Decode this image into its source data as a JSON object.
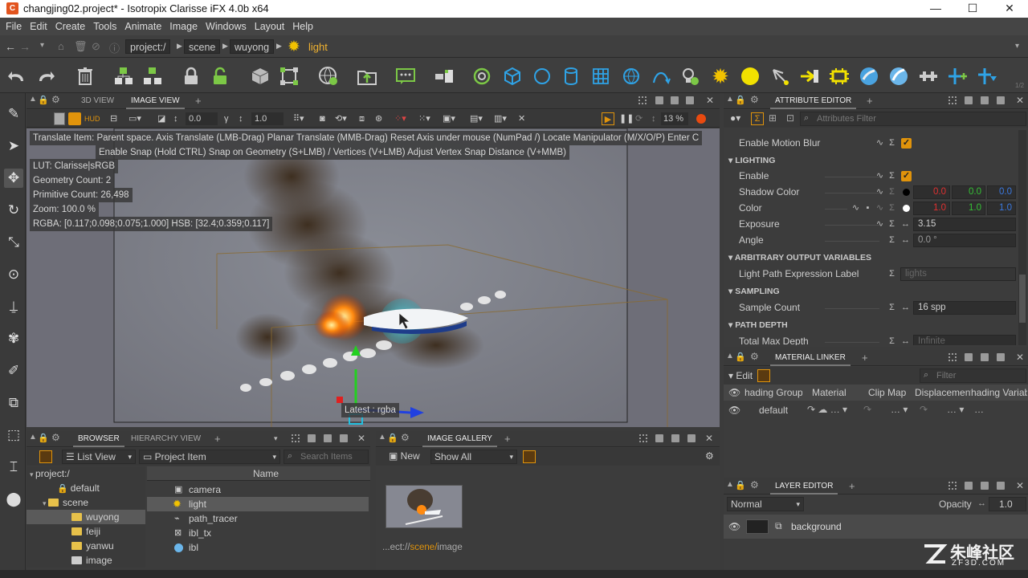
{
  "window": {
    "title": "changjing02.project* - Isotropix Clarisse iFX 4.0b x64",
    "app_icon": "C",
    "minimize": "—",
    "maximize": "☐",
    "close": "✕"
  },
  "menu": [
    "File",
    "Edit",
    "Create",
    "Tools",
    "Animate",
    "Image",
    "Windows",
    "Layout",
    "Help"
  ],
  "breadcrumb": {
    "items": [
      "project:/",
      "scene",
      "wuyong"
    ],
    "current": "light"
  },
  "viewport_tabs": {
    "tab1": "3D VIEW",
    "tab2": "IMAGE VIEW",
    "add": "+"
  },
  "viewport_bar": {
    "exposure": "0.0",
    "gamma": "1.0",
    "zoom": "13 %"
  },
  "viewport_overlay": {
    "help1": "Translate Item: Parent space. Axis Translate (LMB-Drag)  Planar Translate (MMB-Drag) Reset Axis under mouse (NumPad /)  Locate Manipulator (M/X/O/P)  Enter C",
    "help2": "Enable Snap (Hold CTRL) Snap on Geometry (S+LMB) / Vertices (V+LMB) Adjust Vertex Snap Distance (V+MMB)",
    "lut": "LUT: Clarisse|sRGB",
    "geometry_count": "Geometry Count: 2",
    "primitive_count": "Primitive Count: 26,498",
    "zoom": "Zoom: 100.0 %",
    "rgba": "RGBA: [0.117;0.098;0.075;1.000] HSB: [32.4;0.359;0.117]",
    "latest": "Latest : rgba"
  },
  "attribute_editor": {
    "tab": "ATTRIBUTE EDITOR",
    "filter_placeholder": "Attributes Filter",
    "enable_motion_blur": "Enable Motion Blur",
    "sec_lighting": "LIGHTING",
    "enable": "Enable",
    "shadow_color": "Shadow Color",
    "shadow_rgb": [
      "0.0",
      "0.0",
      "0.0"
    ],
    "color": "Color",
    "color_rgb": [
      "1.0",
      "1.0",
      "1.0"
    ],
    "exposure": "Exposure",
    "exposure_val": "3.15",
    "angle": "Angle",
    "angle_val": "0.0 °",
    "sec_aov": "ARBITRARY OUTPUT VARIABLES",
    "light_path_label": "Light Path Expression Label",
    "light_path_val": "lights",
    "sec_sampling": "SAMPLING",
    "sample_count": "Sample Count",
    "sample_count_val": "16 spp",
    "sec_path_depth": "PATH DEPTH",
    "total_max_depth": "Total Max Depth",
    "total_max_depth_val": "Infinite",
    "colors": {
      "red": "#e03030",
      "green": "#35c035",
      "blue": "#3a78e0",
      "check": "#e0930b"
    }
  },
  "material_linker": {
    "tab": "MATERIAL LINKER",
    "edit": "Edit",
    "filter_placeholder": "Filter",
    "cols": [
      "hading Group",
      "Material",
      "Clip Map",
      "Displacement",
      "hading Variab"
    ],
    "row_name": "default"
  },
  "layer_editor": {
    "tab": "LAYER EDITOR",
    "blend": "Normal",
    "opacity_label": "Opacity",
    "opacity": "1.0",
    "layer": "background"
  },
  "browser": {
    "tab1": "BROWSER",
    "tab2": "HIERARCHY VIEW",
    "view_mode": "List View",
    "filter": "Project Item",
    "search_placeholder": "Search Items",
    "col_name": "Name",
    "tree": [
      "project:/",
      "default",
      "scene",
      "wuyong",
      "feiji",
      "yanwu",
      "image"
    ],
    "items": [
      "camera",
      "light",
      "path_tracer",
      "ibl_tx",
      "ibl"
    ]
  },
  "gallery": {
    "tab": "IMAGE GALLERY",
    "new": "New",
    "show": "Show All",
    "thumb_path": "...ect://",
    "thumb_scene": "scene/",
    "thumb_name": "image"
  },
  "watermark": {
    "brand": "朱峰社区",
    "url": "ZF3D.COM"
  }
}
